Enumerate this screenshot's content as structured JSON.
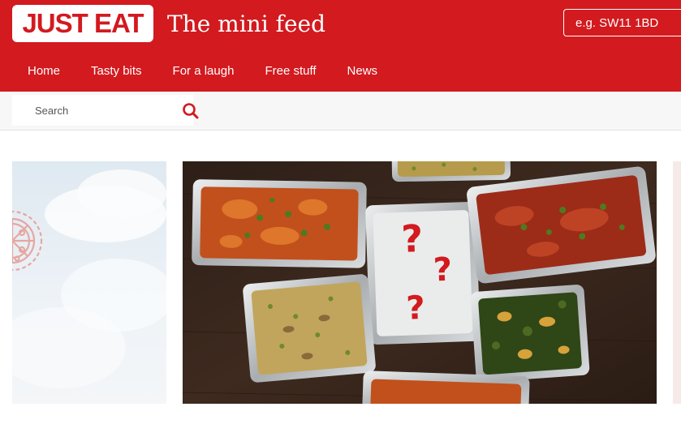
{
  "header": {
    "logo_text": "JUST EAT",
    "site_title": "The mini feed",
    "postcode_placeholder": "e.g. SW11 1BD",
    "brand_color": "#d21a1f"
  },
  "nav": {
    "items": [
      {
        "label": "Home"
      },
      {
        "label": "Tasty bits"
      },
      {
        "label": "For a laugh"
      },
      {
        "label": "Free stuff"
      },
      {
        "label": "News"
      }
    ]
  },
  "search": {
    "placeholder": "Search",
    "icon": "search-icon"
  },
  "hero": {
    "icons": [
      "pizza-icon",
      "question-mark"
    ],
    "question_mark": "?"
  }
}
